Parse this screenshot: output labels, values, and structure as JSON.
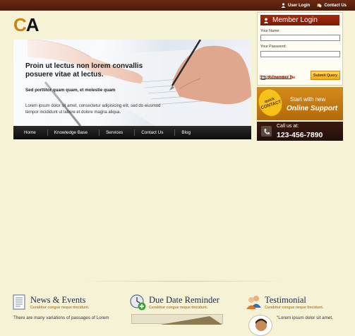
{
  "topbar": {
    "user_login": "User Login",
    "contact_us": "Contact Us"
  },
  "logo": {
    "c": "C",
    "a": "A"
  },
  "hero": {
    "title": "Proin ut lectus non lorem convallis posuere vitae at lectus.",
    "subtitle": "Sed porttitor quam quam, et molestie quam",
    "body": "Lorem ipsum dolor sit amet, consectetur adipisicing elit, sed do eiusmod tempor incididunt ut labore et dolore magna aliqua."
  },
  "nav": {
    "items": [
      "Home",
      "Knowledge Base",
      "Services",
      "Contact Us",
      "Blog"
    ]
  },
  "login": {
    "heading": "Member Login",
    "username_label": "Your Name:",
    "password_label": "Your Password:",
    "username_value": "",
    "password_value": "",
    "remember_label": "Remember Me",
    "submit_label": "Submit Query",
    "forgot_label": "Forgot Password ?"
  },
  "quick_contact": {
    "badge_line1": "quick",
    "badge_line2": "CONTACT",
    "line1": "Start with new",
    "line2": "Online Support"
  },
  "call_us": {
    "label": "Call us at:",
    "phone": "123-456-7890"
  },
  "features": [
    {
      "title": "News & Events",
      "subtitle": "Curabitur congue neque tincidunt.",
      "body": "There are many variations of passages of Lorem",
      "icon": "newspaper-icon"
    },
    {
      "title": "Due Date Reminder",
      "subtitle": "Curabitur congue neque tincidunt.",
      "body": "",
      "icon": "clock-add-icon"
    },
    {
      "title": "Testimonial",
      "subtitle": "Curabitur congue neque tincidunt.",
      "body": "\"Lorem ipsum dolor sit amet,",
      "icon": "users-icon"
    }
  ],
  "colors": {
    "background": "#f6f2d6",
    "topbar": "#5a200c",
    "accent_orange": "#c98512",
    "login_header": "#8c2208",
    "nav": "#111111"
  }
}
